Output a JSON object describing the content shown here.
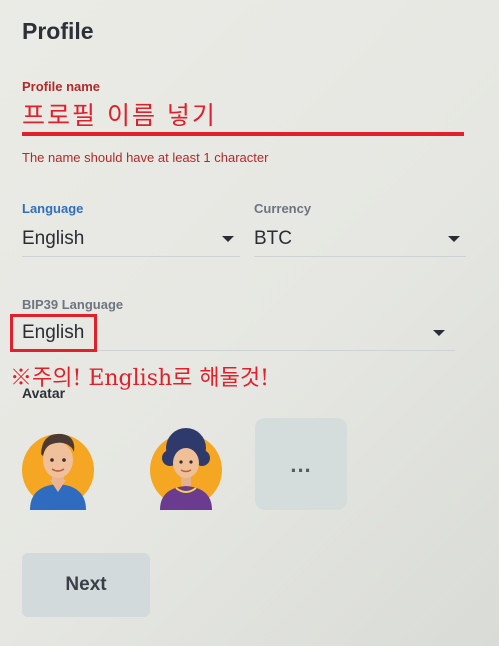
{
  "page": {
    "title": "Profile"
  },
  "profile_name": {
    "label": "Profile name",
    "placeholder": "프로필 이름 넣기",
    "error": "The name should have at least 1 character"
  },
  "language": {
    "label": "Language",
    "value": "English"
  },
  "currency": {
    "label": "Currency",
    "value": "BTC"
  },
  "bip39": {
    "label": "BIP39 Language",
    "value": "English"
  },
  "annotation": {
    "note": "※주의! English로 해둘것!",
    "color": "#e0202b"
  },
  "avatar": {
    "label": "Avatar",
    "options": [
      "man-avatar-icon",
      "woman-avatar-icon"
    ],
    "more_label": "..."
  },
  "footer": {
    "next_label": "Next"
  },
  "colors": {
    "error": "#b02a2a",
    "active_label": "#2f6fbb",
    "button_bg": "#d3dadb"
  }
}
